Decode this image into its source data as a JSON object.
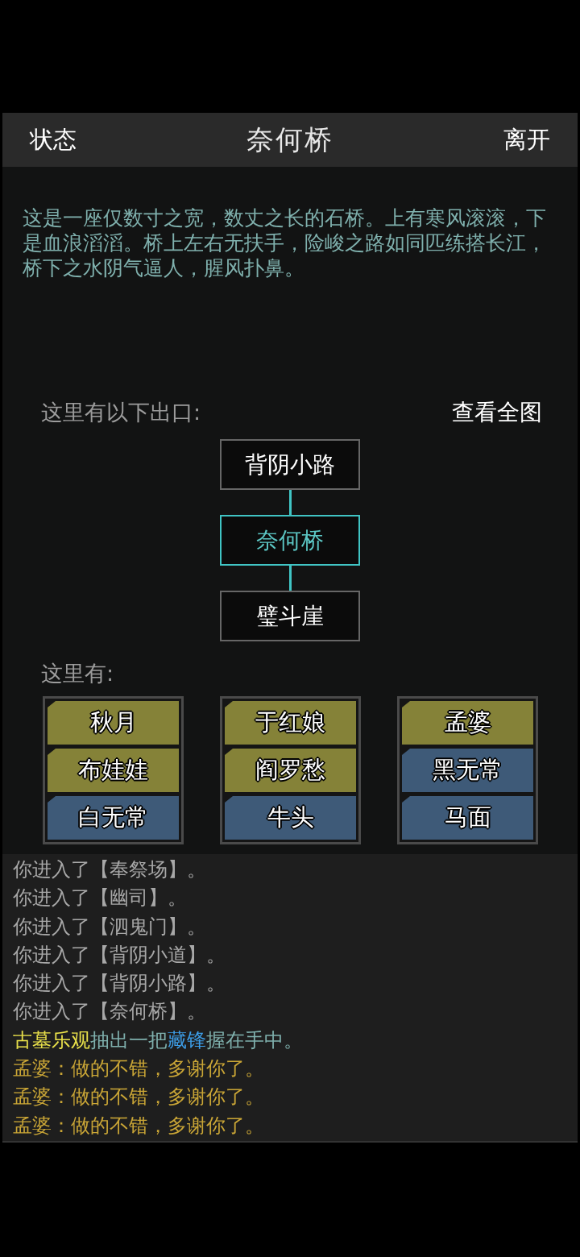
{
  "header": {
    "left": "状态",
    "title": "奈何桥",
    "right": "离开"
  },
  "description": "这是一座仅数寸之宽，数丈之长的石桥。上有寒风滚滚，下是血浪滔滔。桥上左右无扶手，险峻之路如同匹练搭长江，桥下之水阴气逼人，腥风扑鼻。",
  "exits": {
    "label": "这里有以下出口:",
    "map_link": "查看全图",
    "nodes": [
      {
        "name": "背阴小路",
        "selected": false
      },
      {
        "name": "奈何桥",
        "selected": true
      },
      {
        "name": "璧斗崖",
        "selected": false
      }
    ]
  },
  "npcs": {
    "label": "这里有:",
    "columns": [
      {
        "items": [
          {
            "name": "秋月",
            "color": "#858238"
          },
          {
            "name": "布娃娃",
            "color": "#858238"
          },
          {
            "name": "白无常",
            "color": "#3e5a78"
          }
        ]
      },
      {
        "items": [
          {
            "name": "于红娘",
            "color": "#858238"
          },
          {
            "name": "阎罗愁",
            "color": "#858238"
          },
          {
            "name": "牛头",
            "color": "#3e5a78"
          }
        ]
      },
      {
        "items": [
          {
            "name": "孟婆",
            "color": "#858238"
          },
          {
            "name": "黑无常",
            "color": "#3e5a78"
          },
          {
            "name": "马面",
            "color": "#3e5a78"
          }
        ]
      }
    ]
  },
  "log": [
    {
      "kind": "enter",
      "text": "你进入了【奉祭场】。"
    },
    {
      "kind": "enter",
      "text": "你进入了【幽司】。"
    },
    {
      "kind": "enter",
      "text": "你进入了【泗鬼门】。"
    },
    {
      "kind": "enter",
      "text": "你进入了【背阴小道】。"
    },
    {
      "kind": "enter",
      "text": "你进入了【背阴小路】。"
    },
    {
      "kind": "enter",
      "text": "你进入了【奈何桥】。"
    },
    {
      "kind": "action",
      "actor": "古墓乐观",
      "before": "抽出一把",
      "item": "藏锋",
      "after": "握在手中。"
    },
    {
      "kind": "dialog",
      "text": "孟婆：做的不错，多谢你了。"
    },
    {
      "kind": "dialog",
      "text": "孟婆：做的不错，多谢你了。"
    },
    {
      "kind": "dialog",
      "text": "孟婆：做的不错，多谢你了。"
    }
  ]
}
